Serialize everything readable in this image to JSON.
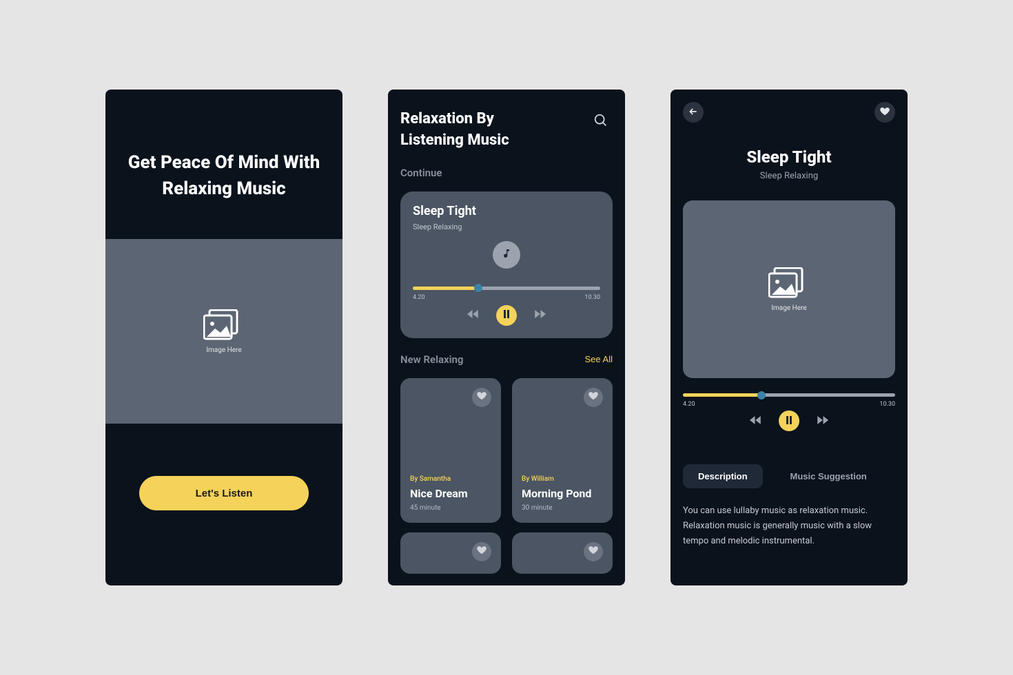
{
  "screen1": {
    "headline": "Get Peace Of Mind With Relaxing Music",
    "image_caption": "Image Here",
    "cta_label": "Let's Listen"
  },
  "screen2": {
    "title_line1": "Relaxation By",
    "title_line2": "Listening Music",
    "continue_label": "Continue",
    "player": {
      "title": "Sleep Tight",
      "subtitle": "Sleep Relaxing",
      "elapsed": "4.20",
      "total": "10.30",
      "progress_pct": 35
    },
    "new_label": "New Relaxing",
    "see_all": "See All",
    "tracks": [
      {
        "author": "By Samantha",
        "title": "Nice Dream",
        "duration": "45 minute"
      },
      {
        "author": "By William",
        "title": "Morning Pond",
        "duration": "30 minute"
      }
    ]
  },
  "screen3": {
    "title": "Sleep Tight",
    "subtitle": "Sleep Relaxing",
    "image_caption": "Image Here",
    "player": {
      "elapsed": "4.20",
      "total": "10.30",
      "progress_pct": 37
    },
    "tabs": {
      "description": "Description",
      "suggestion": "Music Suggestion"
    },
    "description_text": "You can use lullaby music as relaxation music. Relaxation music is generally music with a slow tempo and melodic instrumental."
  }
}
